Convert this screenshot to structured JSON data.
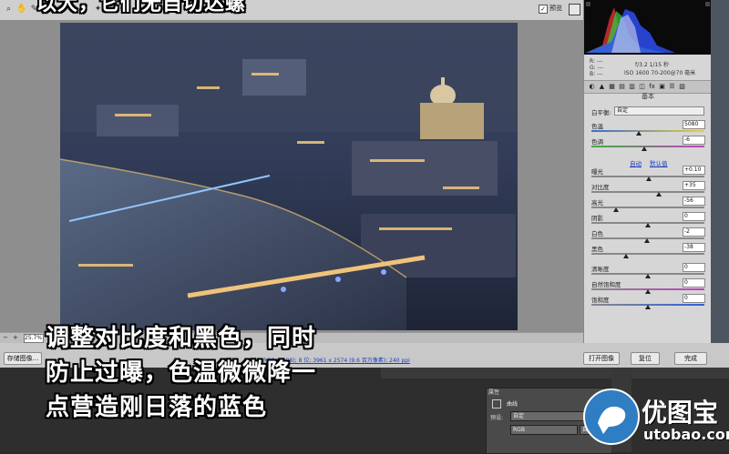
{
  "overlay": {
    "top_caption": "以大，它们无自切达螺",
    "caption_lines": [
      "调整对比度和黑色，同时",
      "防止过曝，色温微微降一",
      "点营造刚日落的蓝色"
    ]
  },
  "toolbar": {
    "tools": [
      "magnifier-icon",
      "hand-icon",
      "wb-tool-icon",
      "color-sampler-icon",
      "target-adjust-icon",
      "crop-icon",
      "straighten-icon",
      "spot-removal-icon",
      "redeye-icon",
      "adjust-brush-icon",
      "graduated-filter-icon",
      "radial-filter-icon",
      "prefs-icon",
      "rotate-ccw-icon",
      "rotate-cw-icon"
    ],
    "preview_checked": "✓",
    "preview_label": "预览"
  },
  "status": {
    "zoom_value": "25.7%",
    "filename": "IMG_0617.C"
  },
  "bottom": {
    "save_image": "存储图像...",
    "workflow_link": "Adobe RGB (1998); 8 位; 3961 x 2574 (9.6 百万像素); 240 ppi",
    "open_image": "打开图像",
    "reset": "复位",
    "done": "完成"
  },
  "readouts": {
    "r": "R:  ---",
    "g": "G:  ---",
    "b": "B:  ---",
    "aperture_shutter": "f/3.2   1/15 秒",
    "iso_lens": "ISO 1600   70-200@70 毫米"
  },
  "panel": {
    "title": "基本",
    "wb_label": "白平衡:",
    "wb_value": "自定",
    "tabs": [
      "basic-icon",
      "tone-curve-icon",
      "detail-icon",
      "hsl-icon",
      "split-tone-icon",
      "lens-icon",
      "fx-icon",
      "camera-cal-icon",
      "presets-icon",
      "snapshots-icon"
    ],
    "sliders_top": [
      {
        "label": "色温",
        "value": "5080",
        "fraction": 0.42
      },
      {
        "label": "色调",
        "value": "-6",
        "fraction": 0.47
      }
    ],
    "auto_label": "自动",
    "default_label": "默认值",
    "sliders_tone": [
      {
        "label": "曝光",
        "value": "+0.10",
        "fraction": 0.51
      },
      {
        "label": "对比度",
        "value": "+35",
        "fraction": 0.6
      },
      {
        "label": "高光",
        "value": "-56",
        "fraction": 0.22
      },
      {
        "label": "阴影",
        "value": "0",
        "fraction": 0.5
      },
      {
        "label": "白色",
        "value": "-2",
        "fraction": 0.49
      },
      {
        "label": "黑色",
        "value": "-38",
        "fraction": 0.31
      }
    ],
    "sliders_presence": [
      {
        "label": "清晰度",
        "value": "0",
        "fraction": 0.5
      },
      {
        "label": "自然饱和度",
        "value": "0",
        "fraction": 0.5
      },
      {
        "label": "饱和度",
        "value": "0",
        "fraction": 0.5
      }
    ]
  },
  "ps": {
    "props_tab": "属性",
    "curves_label": "曲线",
    "preset_label": "预设:",
    "preset_value": "自定",
    "channel_value": "RGB",
    "auto_btn": "自动"
  },
  "watermark": {
    "cn": "优图宝",
    "url": "utobao.com"
  },
  "colors": {
    "accent_link": "#1a3fbf",
    "watermark_blue": "#2f7dc2"
  }
}
